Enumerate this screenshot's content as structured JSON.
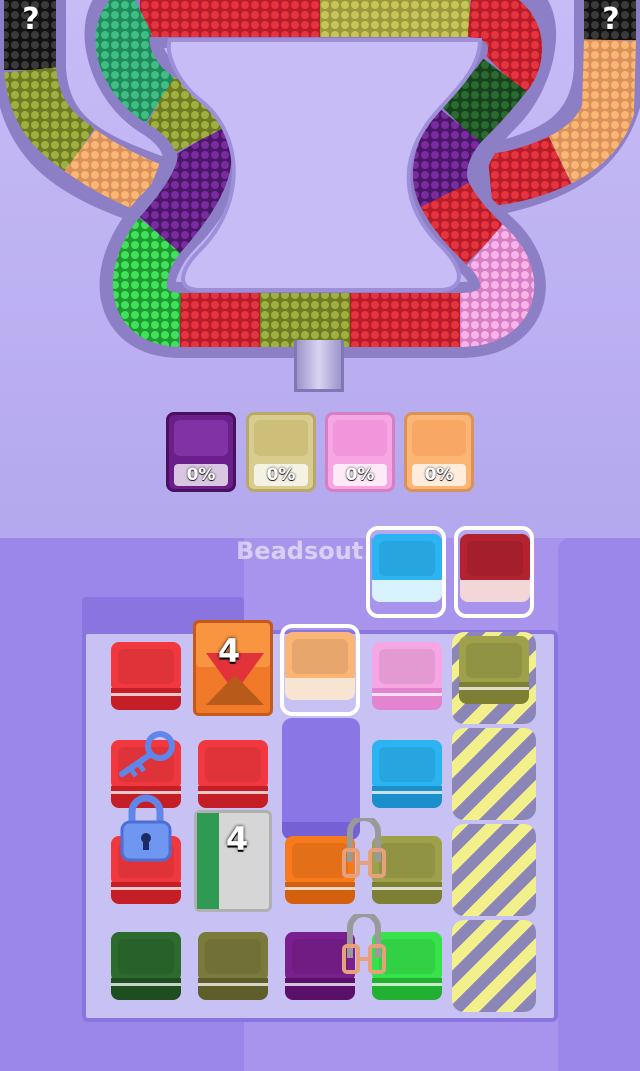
{
  "watermark": "Beadsout.org",
  "hidden_badges": [
    "?",
    "?"
  ],
  "collector_cups": [
    {
      "color": "#6a1f8a",
      "percent": "0%"
    },
    {
      "color": "#d9cc8f",
      "percent": "0%"
    },
    {
      "color": "#f7a6e4",
      "percent": "0%"
    },
    {
      "color": "#fbb676",
      "percent": "0%"
    }
  ],
  "queue_slots": [
    {
      "color": "#2bb3f2"
    },
    {
      "color": "#b2222f"
    }
  ],
  "boxes": [
    {
      "label": "4",
      "kind": "mystery-crate"
    },
    {
      "label": "4",
      "kind": "stone-block"
    }
  ],
  "grid_tiles": [
    {
      "row": 0,
      "col": 0,
      "color": "#f0383e"
    },
    {
      "row": 0,
      "col": 2,
      "color": "#fbb676"
    },
    {
      "row": 0,
      "col": 3,
      "color": "#f7a6e4"
    },
    {
      "row": 0,
      "col": 4,
      "color": "#9ea04a"
    },
    {
      "row": 1,
      "col": 0,
      "color": "#f0383e"
    },
    {
      "row": 1,
      "col": 1,
      "color": "#f0383e"
    },
    {
      "row": 1,
      "col": 3,
      "color": "#2bb3f2"
    },
    {
      "row": 2,
      "col": 0,
      "color": "#f0383e"
    },
    {
      "row": 2,
      "col": 2,
      "color": "#f77a1c"
    },
    {
      "row": 2,
      "col": 3,
      "color": "#9ea04a"
    },
    {
      "row": 3,
      "col": 0,
      "color": "#2d6a2e"
    },
    {
      "row": 3,
      "col": 1,
      "color": "#7a7a3c"
    },
    {
      "row": 3,
      "col": 2,
      "color": "#7a1f8f"
    },
    {
      "row": 3,
      "col": 3,
      "color": "#37e24b"
    }
  ],
  "colors": {
    "bg": "#b9aef0",
    "track_wall": "#8d7fc6",
    "board": "#9b86ea"
  }
}
